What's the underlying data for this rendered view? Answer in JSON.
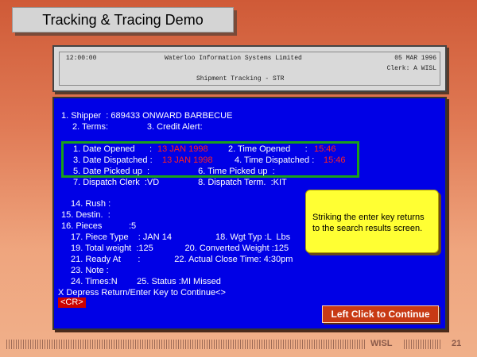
{
  "slide_title": "Tracking & Tracing Demo",
  "header": {
    "time": "12:00:00",
    "company": "Waterloo Information Systems Limited",
    "date": "05 MAR 1996",
    "clerk": "Clerk: A WISL",
    "screen_title": "Shipment Tracking - STR"
  },
  "form": {
    "l1": "1. Shipper  : 689433 ONWARD BARBECUE",
    "l2": "2. Terms:                3. Credit Alert:",
    "date_opened_label": "1. Date Opened      :",
    "date_opened_value": "13 JAN 1998",
    "time_opened_label": "2. Time Opened      :",
    "time_opened_value": "15:46",
    "date_dispatched_label": "3. Date Dispatched :",
    "date_dispatched_value": "13 JAN 1998",
    "time_dispatched_label": "4. Time Dispatched :",
    "time_dispatched_value": "15:46",
    "l5": "5. Date Picked up  :                    6. Time Picked up  :",
    "l6": "7. Dispatch Clerk  :VD                8. Dispatch Term.  :KIT",
    "l7": "14. Rush :",
    "l8": "15. Destin.  :",
    "l9": "16. Pieces           :5",
    "l10": "17. Piece Type    : JAN 14                  18. Wgt Typ :L  Lbs",
    "l11": "19. Total weight  :125             20. Converted Weight :125",
    "l12": "21. Ready At       :              22. Actual Close Time: 4:30pm",
    "l13": "23. Note :",
    "l14": "24. Times:N        25. Status :MI Missed",
    "l15": "X Depress Return/Enter Key to Continue<>",
    "cr": "<CR>"
  },
  "note_text": "Striking the enter key returns to the search results screen.",
  "continue_label": "Left Click to Continue",
  "footer": {
    "brand": "WISL",
    "page": "21"
  }
}
